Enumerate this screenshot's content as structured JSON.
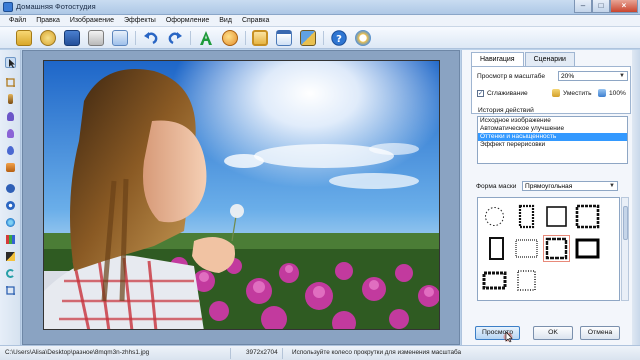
{
  "window": {
    "title": "Домашняя Фотостудия"
  },
  "menu": [
    "Файл",
    "Правка",
    "Изображение",
    "Эффекты",
    "Оформление",
    "Вид",
    "Справка"
  ],
  "toolbar": {
    "buttons": [
      "open-folder",
      "open-globe",
      "save",
      "print",
      "export",
      "undo",
      "redo",
      "text",
      "palette",
      "frame",
      "calendar",
      "collage",
      "help",
      "settings"
    ]
  },
  "left_tools": [
    "pointer",
    "crop",
    "brush",
    "fill",
    "eyedropper",
    "drop",
    "effect",
    "stamp",
    "levels",
    "red-eye",
    "text",
    "rotate",
    "frame-tool"
  ],
  "panel": {
    "tabs": [
      "Навигация",
      "Сценарии"
    ],
    "active_tab": "Навигация",
    "zoom_label": "Просмотр в масштабе",
    "zoom_value": "20%",
    "smoothing_label": "Сглаживание",
    "smoothing_checked": true,
    "fit_label": "Уместить",
    "full_label": "100%",
    "history_label": "История действий",
    "history": [
      "Исходное изображение",
      "Автоматическое улучшение",
      "Оттенки и насыщенность",
      "Эффект перерисовки"
    ],
    "history_selected": 2,
    "mask_label": "Форма маски",
    "mask_value": "Прямоугольная"
  },
  "buttons": {
    "preview": "Просмотр",
    "ok": "OK",
    "cancel": "Отмена"
  },
  "status": {
    "path": "C:\\Users\\Alisa\\Desktop\\разное\\8mqm3n-zhhs1.jpg",
    "dimensions": "3972x2704",
    "hint": "Используйте колесо прокрутки для изменения масштаба"
  },
  "colors": {
    "selection": "#3399ff",
    "sky": "#3d8fe0",
    "flowers": "#c23a9e"
  }
}
